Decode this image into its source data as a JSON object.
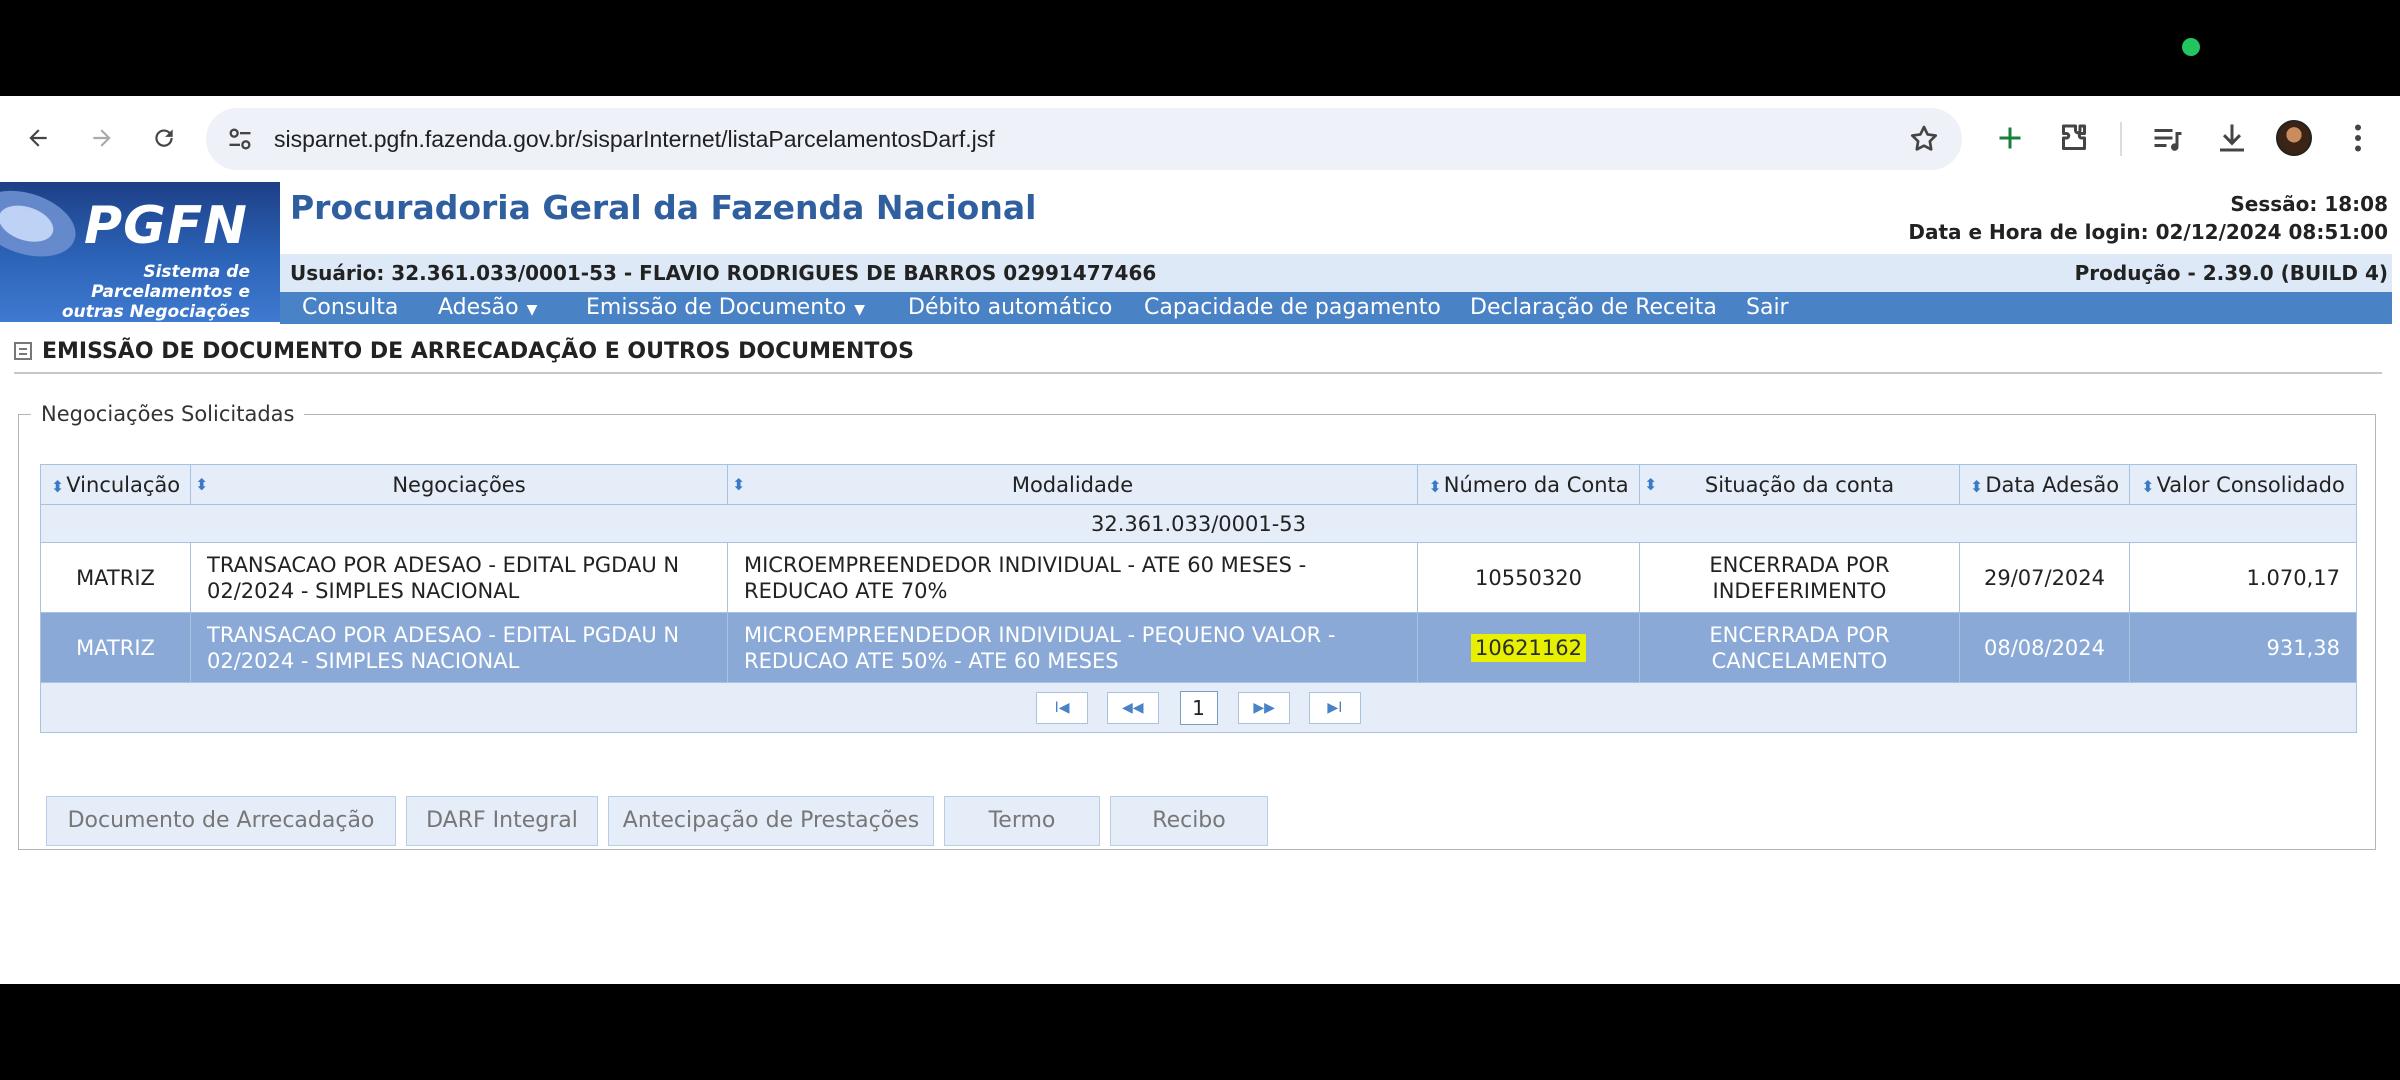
{
  "browser": {
    "url": "sisparnet.pgfn.fazenda.gov.br/sisparInternet/listaParcelamentosDarf.jsf"
  },
  "header": {
    "logo_text": "PGFN",
    "logo_subtitle": "Sistema de Parcelamentos e outras Negociações",
    "title": "Procuradoria Geral da Fazenda Nacional",
    "session": "Sessão: 18:08",
    "login_time": "Data e Hora de login: 02/12/2024 08:51:00",
    "user": "Usuário: 32.361.033/0001-53 - FLAVIO RODRIGUES DE BARROS 02991477466",
    "environment": "Produção - 2.39.0 (BUILD 4)"
  },
  "menu": {
    "items": [
      {
        "label": "Consulta"
      },
      {
        "label": "Adesão",
        "dropdown": true
      },
      {
        "label": "Emissão de Documento",
        "dropdown": true
      },
      {
        "label": "Débito automático"
      },
      {
        "label": "Capacidade de pagamento"
      },
      {
        "label": "Declaração de Receita"
      },
      {
        "label": "Sair"
      }
    ]
  },
  "section": {
    "title": "EMISSÃO DE DOCUMENTO DE ARRECADAÇÃO E OUTROS DOCUMENTOS",
    "fieldset_legend": "Negociações Solicitadas"
  },
  "table": {
    "caption": "32.361.033/0001-53",
    "headers": [
      "Vinculação",
      "Negociações",
      "Modalidade",
      "Número da Conta",
      "Situação da conta",
      "Data Adesão",
      "Valor Consolidado"
    ],
    "rows": [
      {
        "vinculacao": "MATRIZ",
        "negociacoes": "TRANSACAO POR ADESAO - EDITAL PGDAU N 02/2024 - SIMPLES NACIONAL",
        "modalidade": "MICROEMPREENDEDOR INDIVIDUAL - ATE 60 MESES - REDUCAO ATE 70%",
        "numero_conta": "10550320",
        "situacao": "ENCERRADA POR INDEFERIMENTO",
        "data_adesao": "29/07/2024",
        "valor": "1.070,17",
        "selected": false
      },
      {
        "vinculacao": "MATRIZ",
        "negociacoes": "TRANSACAO POR ADESAO - EDITAL PGDAU N 02/2024 - SIMPLES NACIONAL",
        "modalidade": "MICROEMPREENDEDOR INDIVIDUAL - PEQUENO VALOR - REDUCAO ATE 50% - ATE 60 MESES",
        "numero_conta": "10621162",
        "situacao": "ENCERRADA POR CANCELAMENTO",
        "data_adesao": "08/08/2024",
        "valor": "931,38",
        "selected": true
      }
    ],
    "pager": {
      "first": "I◀",
      "prev": "◀◀",
      "page": "1",
      "next": "▶▶",
      "last": "▶I"
    }
  },
  "actions": {
    "documento_arrecadacao": "Documento de Arrecadação",
    "darf_integral": "DARF Integral",
    "antecipacao": "Antecipação de Prestações",
    "termo": "Termo",
    "recibo": "Recibo"
  }
}
